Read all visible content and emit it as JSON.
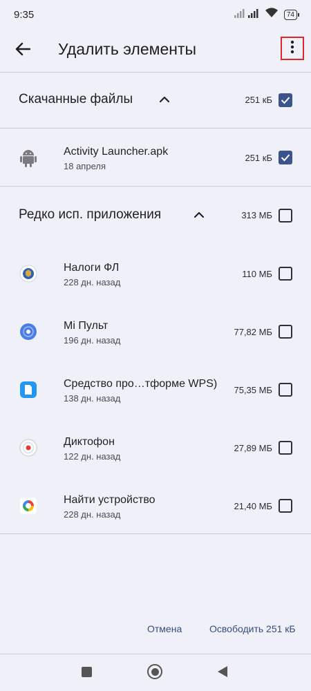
{
  "status": {
    "time": "9:35",
    "battery": "74"
  },
  "header": {
    "title": "Удалить элементы",
    "back_icon": "arrow-left-icon",
    "menu_icon": "more-vertical-icon"
  },
  "groups": [
    {
      "title": "Скачанные файлы",
      "size": "251 кБ",
      "checked": true,
      "expanded": true,
      "items": [
        {
          "name": "Activity Launcher.apk",
          "sub": "18 апреля",
          "size": "251 кБ",
          "checked": true,
          "icon": "android-icon"
        }
      ]
    },
    {
      "title": "Редко исп. приложения",
      "size": "313 МБ",
      "checked": false,
      "expanded": true,
      "items": [
        {
          "name": "Налоги ФЛ",
          "sub": "228 дн. назад",
          "size": "110 МБ",
          "checked": false,
          "icon": "nalogi-app-icon"
        },
        {
          "name": "Mi Пульт",
          "sub": "196 дн. назад",
          "size": "77,82 МБ",
          "checked": false,
          "icon": "mi-remote-app-icon"
        },
        {
          "name": "Средство про…тформе WPS)",
          "sub": "138 дн. назад",
          "size": "75,35 МБ",
          "checked": false,
          "icon": "wps-document-app-icon"
        },
        {
          "name": "Диктофон",
          "sub": "122 дн. назад",
          "size": "27,89 МБ",
          "checked": false,
          "icon": "recorder-app-icon"
        },
        {
          "name": "Найти устройство",
          "sub": "228 дн. назад",
          "size": "21,40 МБ",
          "checked": false,
          "icon": "find-device-app-icon"
        }
      ]
    }
  ],
  "footer": {
    "cancel_label": "Отмена",
    "free_label": "Освободить 251 кБ"
  },
  "colors": {
    "accent": "#3c548c",
    "background": "#f0f1f8",
    "highlight": "#e0262c"
  }
}
